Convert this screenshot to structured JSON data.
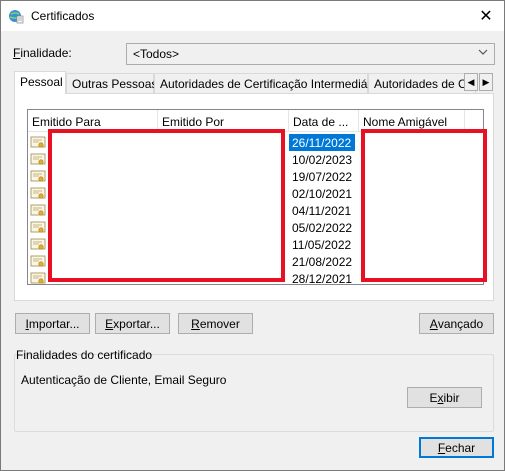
{
  "window": {
    "title": "Certificados",
    "close_glyph": "✕"
  },
  "purpose": {
    "label_key": "F",
    "label_rest": "inalidade:",
    "selected": "<Todos>"
  },
  "tabs": [
    {
      "label": "Pessoal",
      "active": true
    },
    {
      "label": "Outras Pessoas",
      "active": false
    },
    {
      "label": "Autoridades de Certificação Intermediárias",
      "active": false
    },
    {
      "label": "Autoridades de Ce",
      "active": false
    }
  ],
  "tab_scroll": {
    "left": "◀",
    "right": "▶"
  },
  "list": {
    "columns": [
      {
        "label": "Emitido Para"
      },
      {
        "label": "Emitido Por"
      },
      {
        "label": "Data de ..."
      },
      {
        "label": "Nome Amigável"
      }
    ],
    "rows": [
      {
        "date": "26/11/2022",
        "selected": true
      },
      {
        "date": "10/02/2023",
        "selected": false
      },
      {
        "date": "19/07/2022",
        "selected": false
      },
      {
        "date": "02/10/2021",
        "selected": false
      },
      {
        "date": "04/11/2021",
        "selected": false
      },
      {
        "date": "05/02/2022",
        "selected": false
      },
      {
        "date": "11/05/2022",
        "selected": false
      },
      {
        "date": "21/08/2022",
        "selected": false
      },
      {
        "date": "28/12/2021",
        "selected": false
      }
    ],
    "row_icon": "certificate-icon"
  },
  "buttons": {
    "import": {
      "key": "I",
      "rest": "mportar..."
    },
    "export": {
      "key": "E",
      "rest": "xportar..."
    },
    "remove": {
      "key": "R",
      "rest": "emover"
    },
    "advanced": {
      "key": "A",
      "rest": "vançado"
    },
    "view": {
      "pre": "E",
      "key": "x",
      "rest": "ibir"
    },
    "close": {
      "key": "F",
      "rest": "echar"
    }
  },
  "purposes_group": {
    "title": "Finalidades do certificado",
    "text": "Autenticação de Cliente, Email Seguro"
  },
  "colors": {
    "selection": "#0078d7",
    "redaction": "#e81123"
  }
}
